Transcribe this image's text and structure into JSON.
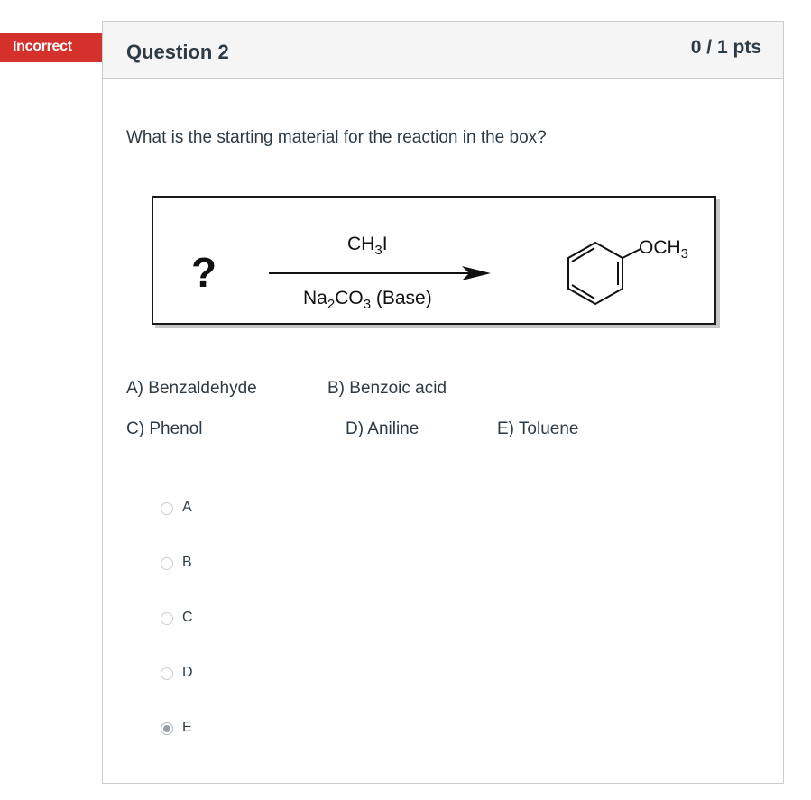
{
  "status_badge": {
    "label": "Incorrect",
    "color": "#d5312c"
  },
  "question": {
    "title": "Question 2",
    "points": "0 / 1 pts",
    "prompt": "What is the starting material for the reaction in the box?"
  },
  "reaction": {
    "reactant": "?",
    "reagent_top": "CH3I",
    "reagent_bottom": "Na2CO3 (Base)",
    "product_substituent": "OCH3"
  },
  "choices": [
    {
      "label": "A) Benzaldehyde"
    },
    {
      "label": "B) Benzoic acid"
    },
    {
      "label": "C) Phenol"
    },
    {
      "label": "D) Aniline"
    },
    {
      "label": "E) Toluene"
    }
  ],
  "answers": [
    {
      "label": "A",
      "selected": false
    },
    {
      "label": "B",
      "selected": false
    },
    {
      "label": "C",
      "selected": false
    },
    {
      "label": "D",
      "selected": false
    },
    {
      "label": "E",
      "selected": true
    }
  ]
}
